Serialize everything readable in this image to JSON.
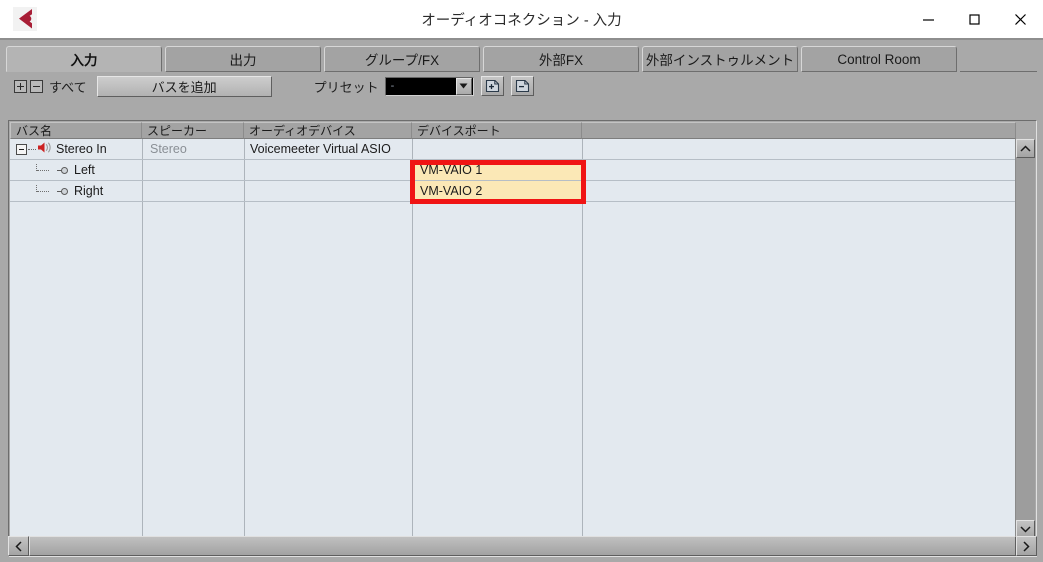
{
  "window": {
    "title": "オーディオコネクション - 入力",
    "logo_icon": "steinberg-cubase-logo",
    "controls": {
      "minimize": "minimize-icon",
      "maximize": "maximize-icon",
      "close": "close-icon"
    }
  },
  "tabs": [
    {
      "label": "入力",
      "active": true
    },
    {
      "label": "出力",
      "active": false
    },
    {
      "label": "グループ/FX",
      "active": false
    },
    {
      "label": "外部FX",
      "active": false
    },
    {
      "label": "外部インストゥルメント",
      "active": false
    },
    {
      "label": "Control Room",
      "active": false
    }
  ],
  "toolbar": {
    "expand_all_icon": "plus-box-icon",
    "collapse_all_icon": "minus-box-icon",
    "all_label": "すべて",
    "add_bus_label": "バスを追加",
    "preset_label": "プリセット",
    "preset_value": "-",
    "preset_dropdown_icon": "chevron-down-icon",
    "store_preset_icon": "page-plus-icon",
    "remove_preset_icon": "page-minus-icon"
  },
  "table": {
    "columns": [
      "バス名",
      "スピーカー",
      "オーディオデバイス",
      "デバイスポート",
      ""
    ],
    "rows": [
      {
        "type": "bus",
        "expander": "minus-box-icon",
        "bus_icon": "speaker-icon",
        "bus_name": "Stereo In",
        "speaker": "Stereo",
        "audio_device": "Voicemeeter Virtual ASIO",
        "device_port": "",
        "highlighted": false
      },
      {
        "type": "channel",
        "port_icon": "port-connector-icon",
        "bus_name": "Left",
        "speaker": "",
        "audio_device": "",
        "device_port": "VM-VAIO 1",
        "highlighted": true
      },
      {
        "type": "channel",
        "port_icon": "port-connector-icon",
        "bus_name": "Right",
        "speaker": "",
        "audio_device": "",
        "device_port": "VM-VAIO 2",
        "highlighted": true
      }
    ]
  },
  "scrollbars": {
    "vertical": {
      "up_icon": "chevron-up-icon",
      "down_icon": "chevron-down-icon"
    },
    "horizontal": {
      "left_icon": "chevron-left-icon",
      "right_icon": "chevron-right-icon"
    }
  },
  "annotation": {
    "color": "#f01414",
    "target": "device-port-cells"
  },
  "colors": {
    "window_chrome": "#a9a9a9",
    "grid_background": "#e3e9ef",
    "highlight_cell": "#fbe8b6",
    "annotation_red": "#f01414",
    "speaker_icon_red": "#cc2222"
  }
}
